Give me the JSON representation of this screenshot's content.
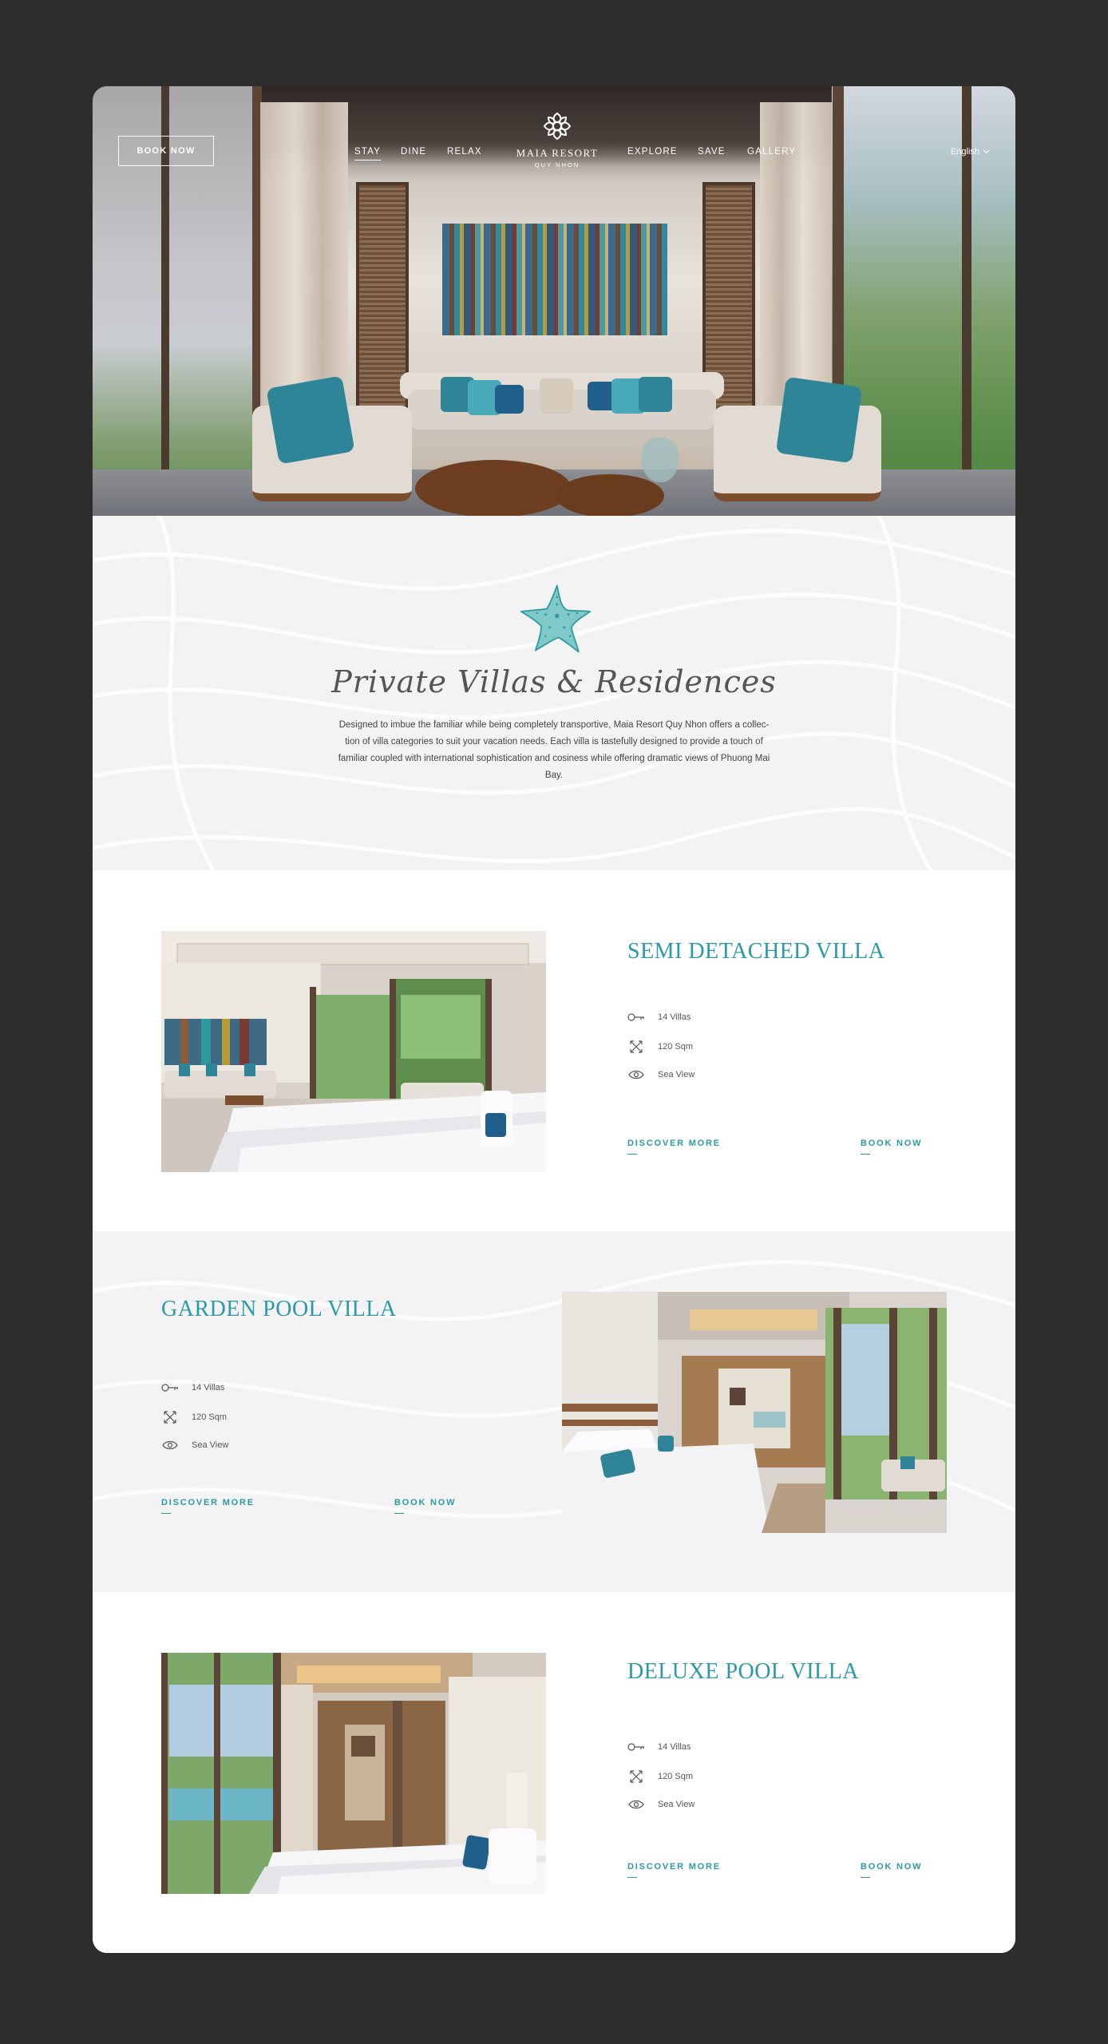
{
  "header": {
    "book_now": "BOOK NOW",
    "nav_left": [
      "STAY",
      "DINE",
      "RELAX"
    ],
    "nav_right": [
      "EXPLORE",
      "SAVE",
      "GALLERY"
    ],
    "logo_name": "MAIA RESORT",
    "logo_sub": "QUY NHON",
    "language": "English",
    "icons": {
      "logo": "lotus-logo-icon",
      "language": "chevron-down-icon"
    }
  },
  "intro": {
    "title": "Private Villas & Residences",
    "text": "Designed to imbue the familiar while being completely transportive, Maia Resort Quy Nhon offers a collec- tion of villa categories to suit your vacation needs. Each villa is tastefully designed to provide a touch of familiar coupled with international sophistication and cosiness while offering dramatic views of Phuong Mai Bay.",
    "icon": "starfish-icon"
  },
  "villas": [
    {
      "title": "SEMI DETACHED VILLA",
      "count": "14 Villas",
      "size": "120 Sqm",
      "view": "Sea View",
      "discover": "DISCOVER MORE",
      "book": "BOOK NOW"
    },
    {
      "title": "GARDEN POOL VILLA",
      "count": "14 Villas",
      "size": "120 Sqm",
      "view": "Sea View",
      "discover": "DISCOVER MORE",
      "book": "BOOK NOW"
    },
    {
      "title": "DELUXE POOL VILLA",
      "count": "14 Villas",
      "size": "120 Sqm",
      "view": "Sea View",
      "discover": "DISCOVER MORE",
      "book": "BOOK NOW"
    }
  ],
  "feature_icons": [
    "key-icon",
    "expand-arrows-icon",
    "eye-icon"
  ],
  "colors": {
    "accent": "#2b9aa6",
    "page_bg": "#2d2d2d",
    "section_grey": "#f3f3f3"
  }
}
